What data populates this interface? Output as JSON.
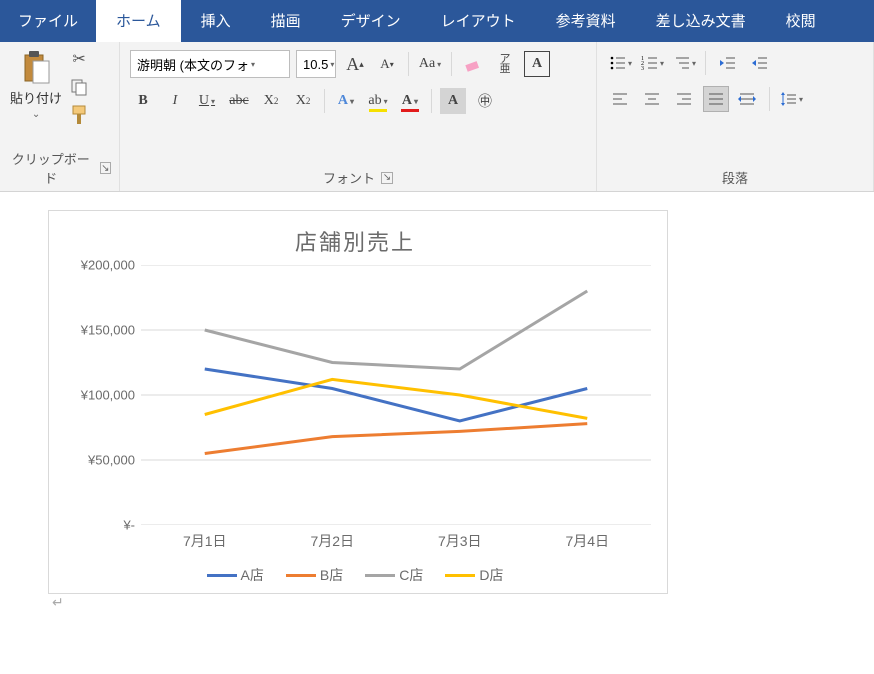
{
  "tabs": {
    "file": "ファイル",
    "home": "ホーム",
    "insert": "挿入",
    "draw": "描画",
    "design": "デザイン",
    "layout": "レイアウト",
    "references": "参考資料",
    "mailmerge": "差し込み文書",
    "review": "校閲"
  },
  "ribbon": {
    "clipboard": {
      "label": "クリップボード",
      "paste": "貼り付け"
    },
    "font": {
      "label": "フォント",
      "name": "游明朝 (本文のフォ",
      "size": "10.5"
    },
    "paragraph": {
      "label": "段落"
    }
  },
  "chart_data": {
    "type": "line",
    "title": "店舗別売上",
    "xlabel": "",
    "ylabel": "",
    "ylim": [
      0,
      200000
    ],
    "categories": [
      "7月1日",
      "7月2日",
      "7月3日",
      "7月4日"
    ],
    "yticks": [
      0,
      50000,
      100000,
      150000,
      200000
    ],
    "ytick_labels": [
      "¥-",
      "¥50,000",
      "¥100,000",
      "¥150,000",
      "¥200,000"
    ],
    "series": [
      {
        "name": "A店",
        "color": "#4472c4",
        "values": [
          120000,
          105000,
          80000,
          105000
        ]
      },
      {
        "name": "B店",
        "color": "#ed7d31",
        "values": [
          55000,
          68000,
          72000,
          78000
        ]
      },
      {
        "name": "C店",
        "color": "#a5a5a5",
        "values": [
          150000,
          125000,
          120000,
          180000
        ]
      },
      {
        "name": "D店",
        "color": "#ffc000",
        "values": [
          85000,
          112000,
          100000,
          82000
        ]
      }
    ]
  }
}
